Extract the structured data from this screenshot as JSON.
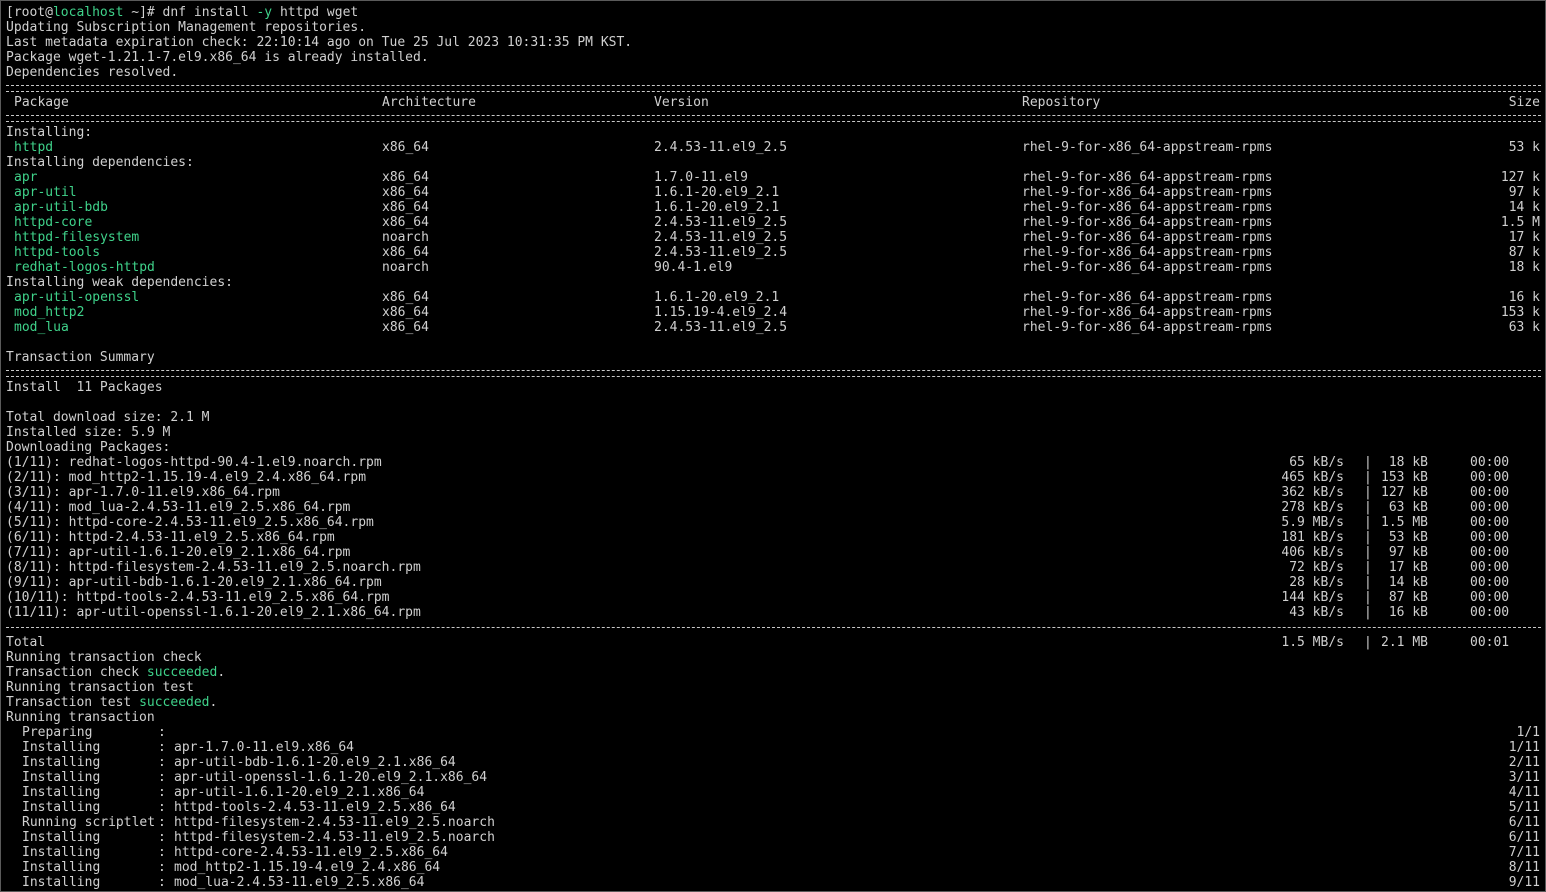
{
  "prompt": {
    "open": "[root@",
    "host": "localhost",
    "rest": " ~]# dnf install ",
    "flag": "-y",
    "args": " httpd wget"
  },
  "intro": [
    "Updating Subscription Management repositories.",
    "Last metadata expiration check: 22:10:14 ago on Tue 25 Jul 2023 10:31:35 PM KST.",
    "Package wget-1.21.1-7.el9.x86_64 is already installed.",
    "Dependencies resolved."
  ],
  "table": {
    "headers": {
      "package": "Package",
      "arch": "Architecture",
      "version": "Version",
      "repo": "Repository",
      "size": "Size"
    },
    "sections": [
      {
        "title": "Installing:",
        "rows": [
          {
            "name": "httpd",
            "arch": "x86_64",
            "version": "2.4.53-11.el9_2.5",
            "repo": "rhel-9-for-x86_64-appstream-rpms",
            "size": "53 k"
          }
        ]
      },
      {
        "title": "Installing dependencies:",
        "rows": [
          {
            "name": "apr",
            "arch": "x86_64",
            "version": "1.7.0-11.el9",
            "repo": "rhel-9-for-x86_64-appstream-rpms",
            "size": "127 k"
          },
          {
            "name": "apr-util",
            "arch": "x86_64",
            "version": "1.6.1-20.el9_2.1",
            "repo": "rhel-9-for-x86_64-appstream-rpms",
            "size": "97 k"
          },
          {
            "name": "apr-util-bdb",
            "arch": "x86_64",
            "version": "1.6.1-20.el9_2.1",
            "repo": "rhel-9-for-x86_64-appstream-rpms",
            "size": "14 k"
          },
          {
            "name": "httpd-core",
            "arch": "x86_64",
            "version": "2.4.53-11.el9_2.5",
            "repo": "rhel-9-for-x86_64-appstream-rpms",
            "size": "1.5 M"
          },
          {
            "name": "httpd-filesystem",
            "arch": "noarch",
            "version": "2.4.53-11.el9_2.5",
            "repo": "rhel-9-for-x86_64-appstream-rpms",
            "size": "17 k"
          },
          {
            "name": "httpd-tools",
            "arch": "x86_64",
            "version": "2.4.53-11.el9_2.5",
            "repo": "rhel-9-for-x86_64-appstream-rpms",
            "size": "87 k"
          },
          {
            "name": "redhat-logos-httpd",
            "arch": "noarch",
            "version": "90.4-1.el9",
            "repo": "rhel-9-for-x86_64-appstream-rpms",
            "size": "18 k"
          }
        ]
      },
      {
        "title": "Installing weak dependencies:",
        "rows": [
          {
            "name": "apr-util-openssl",
            "arch": "x86_64",
            "version": "1.6.1-20.el9_2.1",
            "repo": "rhel-9-for-x86_64-appstream-rpms",
            "size": "16 k"
          },
          {
            "name": "mod_http2",
            "arch": "x86_64",
            "version": "1.15.19-4.el9_2.4",
            "repo": "rhel-9-for-x86_64-appstream-rpms",
            "size": "153 k"
          },
          {
            "name": "mod_lua",
            "arch": "x86_64",
            "version": "2.4.53-11.el9_2.5",
            "repo": "rhel-9-for-x86_64-appstream-rpms",
            "size": "63 k"
          }
        ]
      }
    ]
  },
  "summary": {
    "title": "Transaction Summary",
    "install": "Install  11 Packages",
    "download_size": "Total download size: 2.1 M",
    "installed_size": "Installed size: 5.9 M",
    "downloading": "Downloading Packages:"
  },
  "downloads": [
    {
      "file": "(1/11): redhat-logos-httpd-90.4-1.el9.noarch.rpm",
      "rate": "65 kB/s",
      "size": "18 kB",
      "time": "00:00"
    },
    {
      "file": "(2/11): mod_http2-1.15.19-4.el9_2.4.x86_64.rpm",
      "rate": "465 kB/s",
      "size": "153 kB",
      "time": "00:00"
    },
    {
      "file": "(3/11): apr-1.7.0-11.el9.x86_64.rpm",
      "rate": "362 kB/s",
      "size": "127 kB",
      "time": "00:00"
    },
    {
      "file": "(4/11): mod_lua-2.4.53-11.el9_2.5.x86_64.rpm",
      "rate": "278 kB/s",
      "size": "63 kB",
      "time": "00:00"
    },
    {
      "file": "(5/11): httpd-core-2.4.53-11.el9_2.5.x86_64.rpm",
      "rate": "5.9 MB/s",
      "size": "1.5 MB",
      "time": "00:00"
    },
    {
      "file": "(6/11): httpd-2.4.53-11.el9_2.5.x86_64.rpm",
      "rate": "181 kB/s",
      "size": "53 kB",
      "time": "00:00"
    },
    {
      "file": "(7/11): apr-util-1.6.1-20.el9_2.1.x86_64.rpm",
      "rate": "406 kB/s",
      "size": "97 kB",
      "time": "00:00"
    },
    {
      "file": "(8/11): httpd-filesystem-2.4.53-11.el9_2.5.noarch.rpm",
      "rate": "72 kB/s",
      "size": "17 kB",
      "time": "00:00"
    },
    {
      "file": "(9/11): apr-util-bdb-1.6.1-20.el9_2.1.x86_64.rpm",
      "rate": "28 kB/s",
      "size": "14 kB",
      "time": "00:00"
    },
    {
      "file": "(10/11): httpd-tools-2.4.53-11.el9_2.5.x86_64.rpm",
      "rate": "144 kB/s",
      "size": "87 kB",
      "time": "00:00"
    },
    {
      "file": "(11/11): apr-util-openssl-1.6.1-20.el9_2.1.x86_64.rpm",
      "rate": "43 kB/s",
      "size": "16 kB",
      "time": "00:00"
    }
  ],
  "total": {
    "label": "Total",
    "rate": "1.5 MB/s",
    "size": "2.1 MB",
    "time": "00:01"
  },
  "checks": {
    "running_check": "Running transaction check",
    "check_prefix": "Transaction check ",
    "running_test": "Running transaction test",
    "test_prefix": "Transaction test ",
    "succeeded": "succeeded",
    "period": ".",
    "running": "Running transaction"
  },
  "steps": [
    {
      "action": "Preparing",
      "target": "",
      "progress": "1/1"
    },
    {
      "action": "Installing",
      "target": "apr-1.7.0-11.el9.x86_64",
      "progress": "1/11"
    },
    {
      "action": "Installing",
      "target": "apr-util-bdb-1.6.1-20.el9_2.1.x86_64",
      "progress": "2/11"
    },
    {
      "action": "Installing",
      "target": "apr-util-openssl-1.6.1-20.el9_2.1.x86_64",
      "progress": "3/11"
    },
    {
      "action": "Installing",
      "target": "apr-util-1.6.1-20.el9_2.1.x86_64",
      "progress": "4/11"
    },
    {
      "action": "Installing",
      "target": "httpd-tools-2.4.53-11.el9_2.5.x86_64",
      "progress": "5/11"
    },
    {
      "action": "Running scriptlet",
      "target": "httpd-filesystem-2.4.53-11.el9_2.5.noarch",
      "progress": "6/11"
    },
    {
      "action": "Installing",
      "target": "httpd-filesystem-2.4.53-11.el9_2.5.noarch",
      "progress": "6/11"
    },
    {
      "action": "Installing",
      "target": "httpd-core-2.4.53-11.el9_2.5.x86_64",
      "progress": "7/11"
    },
    {
      "action": "Installing",
      "target": "mod_http2-1.15.19-4.el9_2.4.x86_64",
      "progress": "8/11"
    },
    {
      "action": "Installing",
      "target": "mod_lua-2.4.53-11.el9_2.5.x86_64",
      "progress": "9/11"
    }
  ],
  "colors": {
    "background": "#000000",
    "text": "#d0d0d0",
    "green": "#3fd28a"
  }
}
